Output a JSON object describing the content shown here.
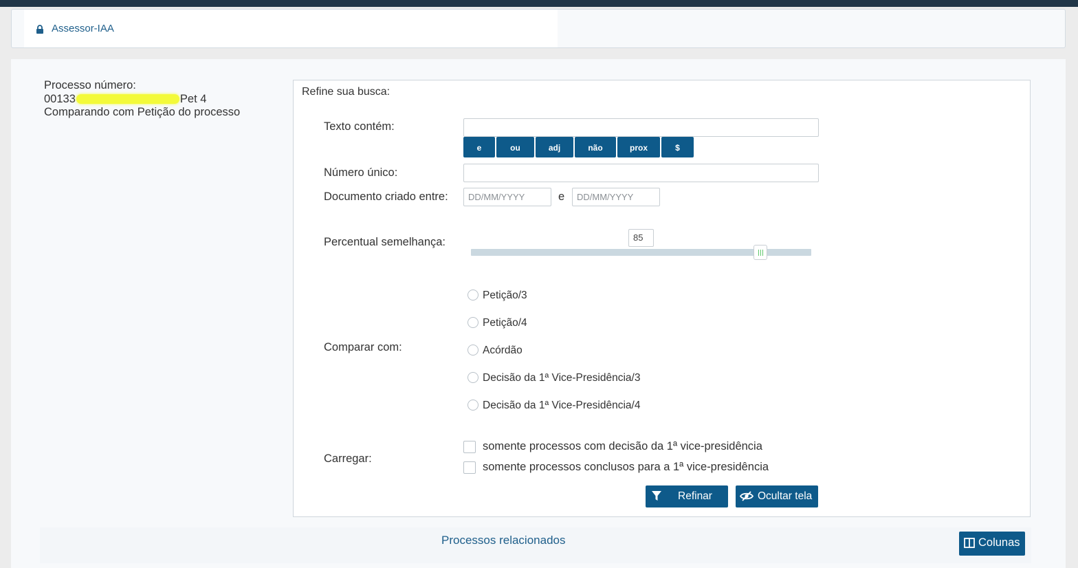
{
  "breadcrumb": {
    "label": "Assessor-IAA",
    "icon": "lock-icon"
  },
  "process_info": {
    "label": "Processo número:",
    "number_prefix": "00133",
    "number_suffix": "Pet 4",
    "comparing_text": "Comparando com Petição do processo"
  },
  "refine": {
    "title": "Refine sua busca:",
    "text_contains_label": "Texto contém:",
    "text_contains_value": "",
    "operators": [
      "e",
      "ou",
      "adj",
      "não",
      "prox",
      "$"
    ],
    "unique_number_label": "Número único:",
    "unique_number_value": "",
    "date_label": "Documento criado entre:",
    "date_from_placeholder": "DD/MM/YYYY",
    "date_separator": "e",
    "date_to_placeholder": "DD/MM/YYYY",
    "similarity_label": "Percentual semelhança:",
    "similarity_value": "85",
    "compare_label": "Comparar com:",
    "compare_options": [
      "Petição/3",
      "Petição/4",
      "Acórdão",
      "Decisão da 1ª Vice-Presidência/3",
      "Decisão da 1ª Vice-Presidência/4"
    ],
    "load_label": "Carregar:",
    "load_options": [
      "somente processos com decisão da 1ª vice-presidência",
      "somente processos conclusos para a 1ª vice-presidência"
    ],
    "refine_button": "Refinar",
    "hide_button": "Ocultar tela"
  },
  "related": {
    "title": "Processos relacionados",
    "columns_button": "Colunas"
  },
  "colors": {
    "primary": "#0e5a8a",
    "link": "#1f5f8b",
    "topbar": "#213648",
    "slider_track": "#cad8e0",
    "slider_grip": "#5ec76b"
  }
}
